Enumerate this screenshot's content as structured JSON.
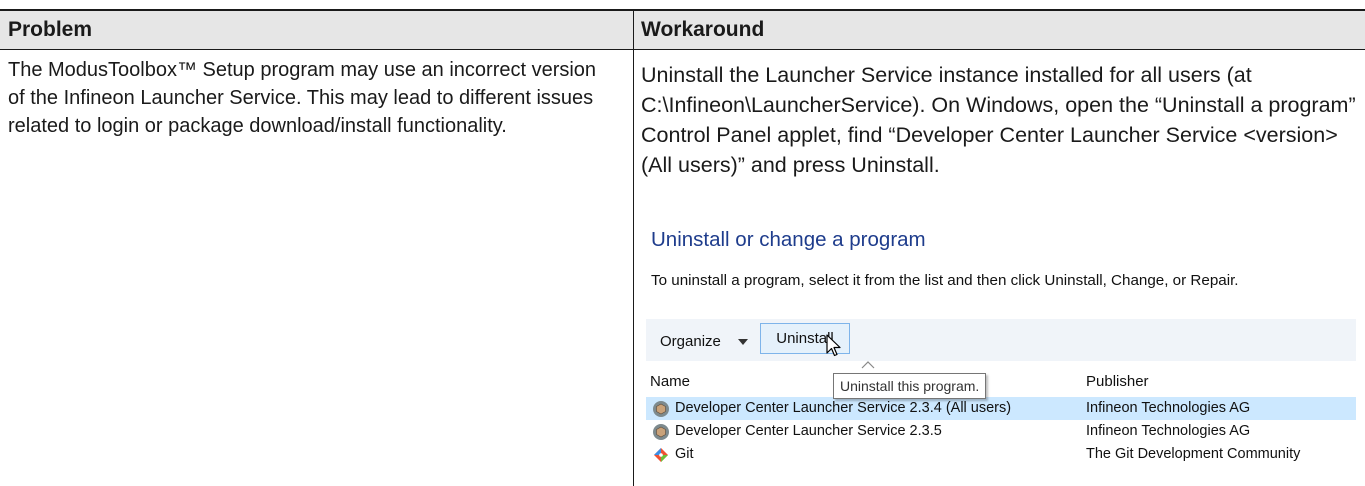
{
  "table": {
    "headers": {
      "problem": "Problem",
      "workaround": "Workaround"
    },
    "problem_text": "The ModusToolbox™ Setup program may use an incorrect version of the Infineon Launcher Service. This may lead to different issues related to login or package download/install functionality.",
    "workaround_text": "Uninstall the Launcher Service instance installed for all users (at C:\\Infineon\\LauncherService). On Windows, open the “Uninstall a program” Control Panel applet, find “Developer Center Launcher Service <version> (All users)” and press Uninstall."
  },
  "control_panel": {
    "title": "Uninstall or change a program",
    "description": "To uninstall a program, select it from the list and then click Uninstall, Change, or Repair.",
    "toolbar": {
      "organize_label": "Organize",
      "uninstall_label": "Uninstall"
    },
    "tooltip": "Uninstall this program.",
    "columns": {
      "name": "Name",
      "publisher": "Publisher"
    },
    "programs": [
      {
        "name": "Developer Center Launcher Service 2.3.4 (All users)",
        "publisher": "Infineon Technologies AG",
        "icon": "launcher-service-icon",
        "selected": true
      },
      {
        "name": "Developer Center Launcher Service 2.3.5",
        "publisher": "Infineon Technologies AG",
        "icon": "launcher-service-icon",
        "selected": false
      },
      {
        "name": "Git",
        "publisher": "The Git Development Community",
        "icon": "git-icon",
        "selected": false
      }
    ]
  },
  "colors": {
    "header_bg": "#e6e6e6",
    "cp_title": "#1e3c8c",
    "toolbar_bg": "#f0f4f9",
    "selected_row": "#cce8ff",
    "button_border": "#7eb4ea"
  }
}
